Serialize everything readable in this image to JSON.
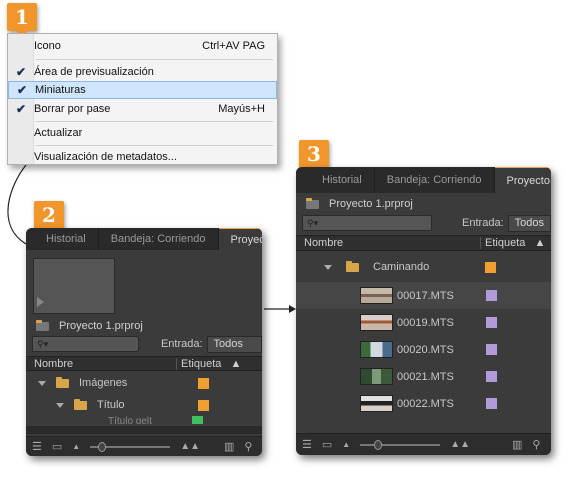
{
  "badges": {
    "one": "1",
    "two": "2",
    "three": "3"
  },
  "menu": {
    "items": [
      {
        "label": "Icono",
        "shortcut": "Ctrl+AV PAG",
        "checked": false
      },
      {
        "label": "Área de previsualización",
        "shortcut": "",
        "checked": true
      },
      {
        "label": "Miniaturas",
        "shortcut": "",
        "checked": true
      },
      {
        "label": "Borrar por pase",
        "shortcut": "Mayús+H",
        "checked": true
      },
      {
        "label": "Actualizar",
        "shortcut": "",
        "checked": false
      },
      {
        "label": "Visualización de metadatos...",
        "shortcut": "",
        "checked": false
      }
    ]
  },
  "panel_small": {
    "tabs": [
      "Historial",
      "Bandeja: Corriendo",
      "Proyecto: Proy"
    ],
    "file": "Proyecto 1.prproj",
    "entrada_label": "Entrada:",
    "entrada_value": "Todos",
    "col_name": "Nombre",
    "col_label": "Etiqueta",
    "rows": [
      {
        "name": "Imágenes",
        "color": "#f0a030"
      },
      {
        "name": "Título",
        "color": "#f0a030"
      },
      {
        "name": "Título gelt",
        "color": "#40c060"
      }
    ]
  },
  "panel_large": {
    "tabs": [
      "Historial",
      "Bandeja: Corriendo",
      "Proyecto: P"
    ],
    "file": "Proyecto 1.prproj",
    "entrada_label": "Entrada:",
    "entrada_value": "Todos",
    "col_name": "Nombre",
    "col_label": "Etiqueta",
    "folder": {
      "name": "Caminando",
      "color": "#f0a030"
    },
    "clips": [
      {
        "name": "00017.MTS",
        "color": "#b09ad8"
      },
      {
        "name": "00019.MTS",
        "color": "#b09ad8"
      },
      {
        "name": "00020.MTS",
        "color": "#b09ad8"
      },
      {
        "name": "00021.MTS",
        "color": "#b09ad8"
      },
      {
        "name": "00022.MTS",
        "color": "#b09ad8"
      }
    ]
  },
  "icons": [
    "checkmark-icon",
    "folder-icon",
    "search-icon",
    "list-view-icon",
    "icon-view-icon",
    "zoom-slider-icon"
  ]
}
